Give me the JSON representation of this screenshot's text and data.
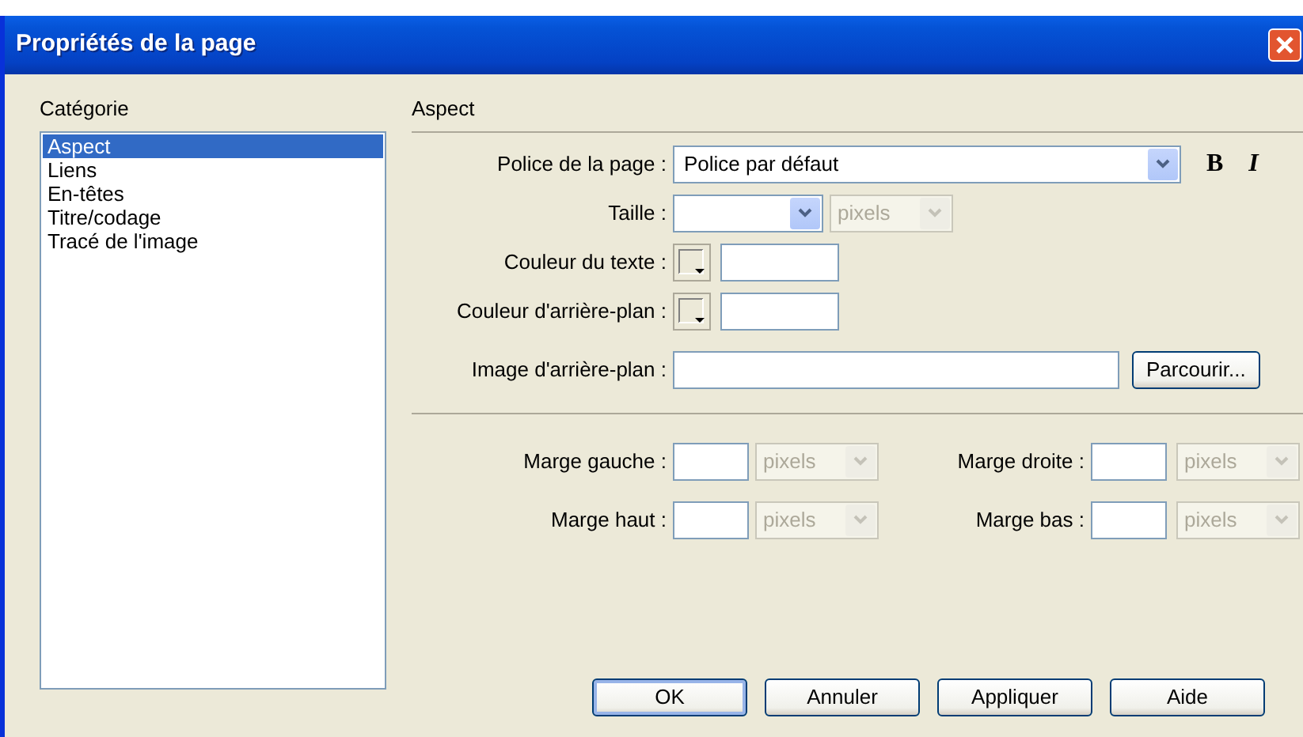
{
  "window": {
    "title": "Propriétés de la page"
  },
  "category": {
    "label": "Catégorie",
    "items": [
      {
        "label": "Aspect",
        "selected": true
      },
      {
        "label": "Liens",
        "selected": false
      },
      {
        "label": "En-têtes",
        "selected": false
      },
      {
        "label": "Titre/codage",
        "selected": false
      },
      {
        "label": "Tracé de l'image",
        "selected": false
      }
    ]
  },
  "panel": {
    "title": "Aspect"
  },
  "font": {
    "label": "Police de la page :",
    "value": "Police par défaut",
    "bold_button": "B",
    "italic_button": "I"
  },
  "size": {
    "label": "Taille :",
    "unit": "pixels",
    "unit_disabled": true
  },
  "colors": [
    {
      "label": "Couleur du texte :"
    },
    {
      "label": "Couleur d'arrière-plan :"
    }
  ],
  "background_image": {
    "label": "Image d'arrière-plan :",
    "button": "Parcourir..."
  },
  "margins": [
    {
      "label": "Marge gauche :",
      "unit": "pixels",
      "disabled": true
    },
    {
      "label": "Marge droite :",
      "unit": "pixels",
      "disabled": true
    },
    {
      "label": "Marge haut :",
      "unit": "pixels",
      "disabled": true
    },
    {
      "label": "Marge bas :",
      "unit": "pixels",
      "disabled": true
    }
  ],
  "buttons": [
    {
      "label": "OK",
      "default": true
    },
    {
      "label": "Annuler",
      "default": false
    },
    {
      "label": "Appliquer",
      "default": false
    },
    {
      "label": "Aide",
      "default": false
    }
  ]
}
